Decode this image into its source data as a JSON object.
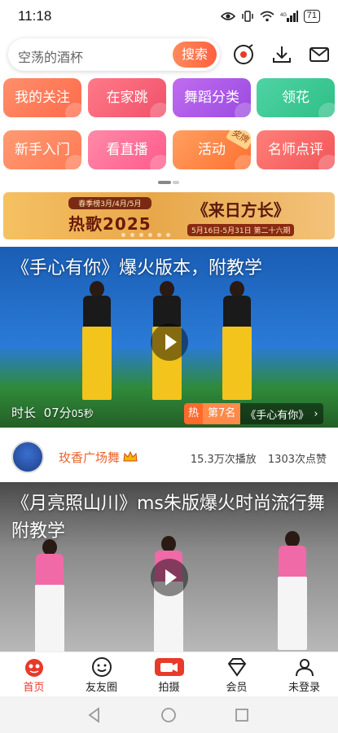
{
  "status": {
    "time": "11:18",
    "battery": "71"
  },
  "search": {
    "placeholder": "空荡的酒杯",
    "button_label": "搜索"
  },
  "categories": [
    {
      "label": "我的关注",
      "color_from": "#ff8f6b",
      "color_to": "#ff6a4a"
    },
    {
      "label": "在家跳",
      "color_from": "#ff7a88",
      "color_to": "#f0506a"
    },
    {
      "label": "舞蹈分类",
      "color_from": "#c06cf0",
      "color_to": "#9a4ae0"
    },
    {
      "label": "领花",
      "color_from": "#4fd3a4",
      "color_to": "#2fbf86"
    },
    {
      "label": "新手入门",
      "color_from": "#ff9a72",
      "color_to": "#ff7a55"
    },
    {
      "label": "看直播",
      "color_from": "#ff8aa8",
      "color_to": "#ff5a8a"
    },
    {
      "label": "活动",
      "color_from": "#ffa060",
      "color_to": "#ff7030",
      "badge": "奖牌"
    },
    {
      "label": "名师点评",
      "color_from": "#ff7f78",
      "color_to": "#f2555a"
    }
  ],
  "banner": {
    "small_text": "春季榜3月/4月/5月",
    "big_text": "热歌2025",
    "title": "《来日方长》",
    "date_text": "5月16日-5月31日 第二十六期"
  },
  "videos": [
    {
      "title": "《手心有你》爆火版本，附教学",
      "duration_label": "时长",
      "duration_min": "07分",
      "duration_sec": "05秒",
      "rank_hot": "热",
      "rank_num": "第7名",
      "rank_song": "《手心有你》",
      "author": "玫香广场舞",
      "plays": "15.3万次播放",
      "likes": "1303次点赞"
    },
    {
      "title": "《月亮照山川》ms朱版爆火时尚流行舞附教学"
    }
  ],
  "tabs": [
    {
      "label": "首页",
      "icon": "home-icon"
    },
    {
      "label": "友友圈",
      "icon": "smiley-icon"
    },
    {
      "label": "拍摄",
      "icon": "camera-icon"
    },
    {
      "label": "会员",
      "icon": "diamond-icon"
    },
    {
      "label": "未登录",
      "icon": "user-icon"
    }
  ],
  "colors": {
    "accent": "#e83a2a",
    "author": "#e8642a"
  }
}
